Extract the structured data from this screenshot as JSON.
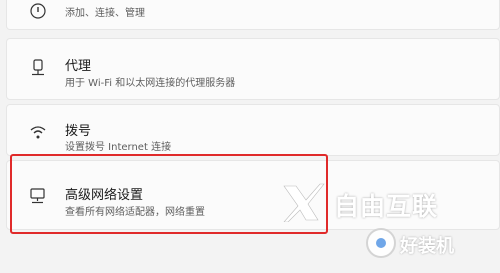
{
  "settings": {
    "items": [
      {
        "title": "",
        "subtitle": "添加、连接、管理",
        "icon": "info-icon"
      },
      {
        "title": "代理",
        "subtitle": "用于 Wi-Fi 和以太网连接的代理服务器",
        "icon": "proxy-icon"
      },
      {
        "title": "拨号",
        "subtitle": "设置拨号 Internet 连接",
        "icon": "dialup-icon"
      },
      {
        "title": "高级网络设置",
        "subtitle": "查看所有网络适配器，网络重置",
        "icon": "advanced-network-icon"
      }
    ]
  },
  "highlight_color": "#e02a2a",
  "watermark": {
    "brand": "自由互联",
    "site": "好装机"
  }
}
